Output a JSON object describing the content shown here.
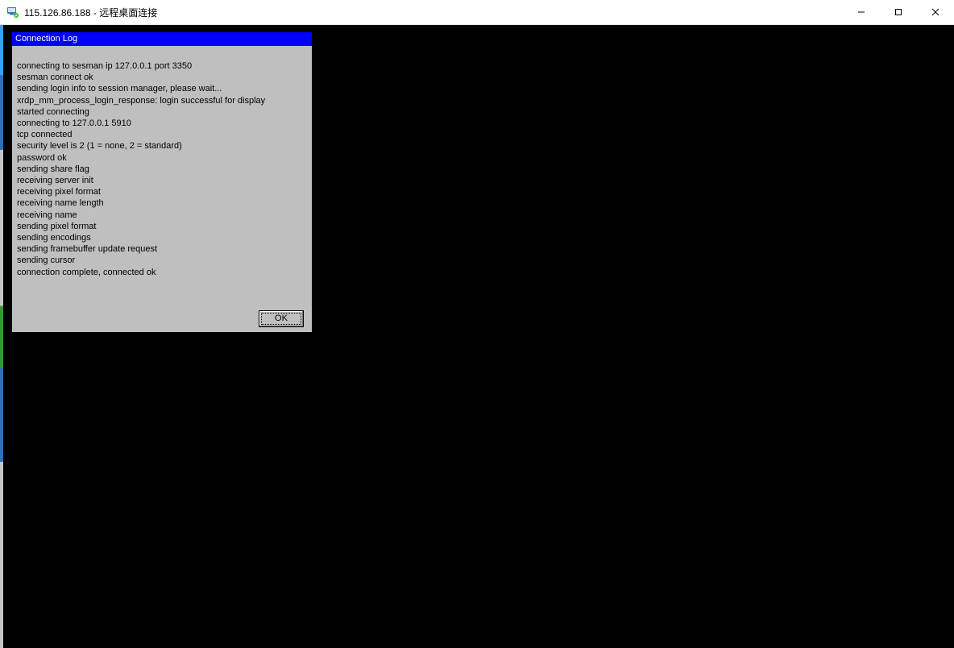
{
  "window": {
    "title": "115.126.86.188 - 远程桌面连接"
  },
  "dialog": {
    "title": "Connection Log",
    "ok_label": "OK",
    "lines": [
      "connecting to sesman ip 127.0.0.1 port 3350",
      "sesman connect ok",
      "sending login info to session manager, please wait...",
      "xrdp_mm_process_login_response: login successful for display",
      "started connecting",
      "connecting to 127.0.0.1 5910",
      "tcp connected",
      "security level is 2 (1 = none, 2 = standard)",
      "password ok",
      "sending share flag",
      "receiving server init",
      "receiving pixel format",
      "receiving name length",
      "receiving name",
      "sending pixel format",
      "sending encodings",
      "sending framebuffer update request",
      "sending cursor",
      "connection complete, connected ok"
    ]
  }
}
